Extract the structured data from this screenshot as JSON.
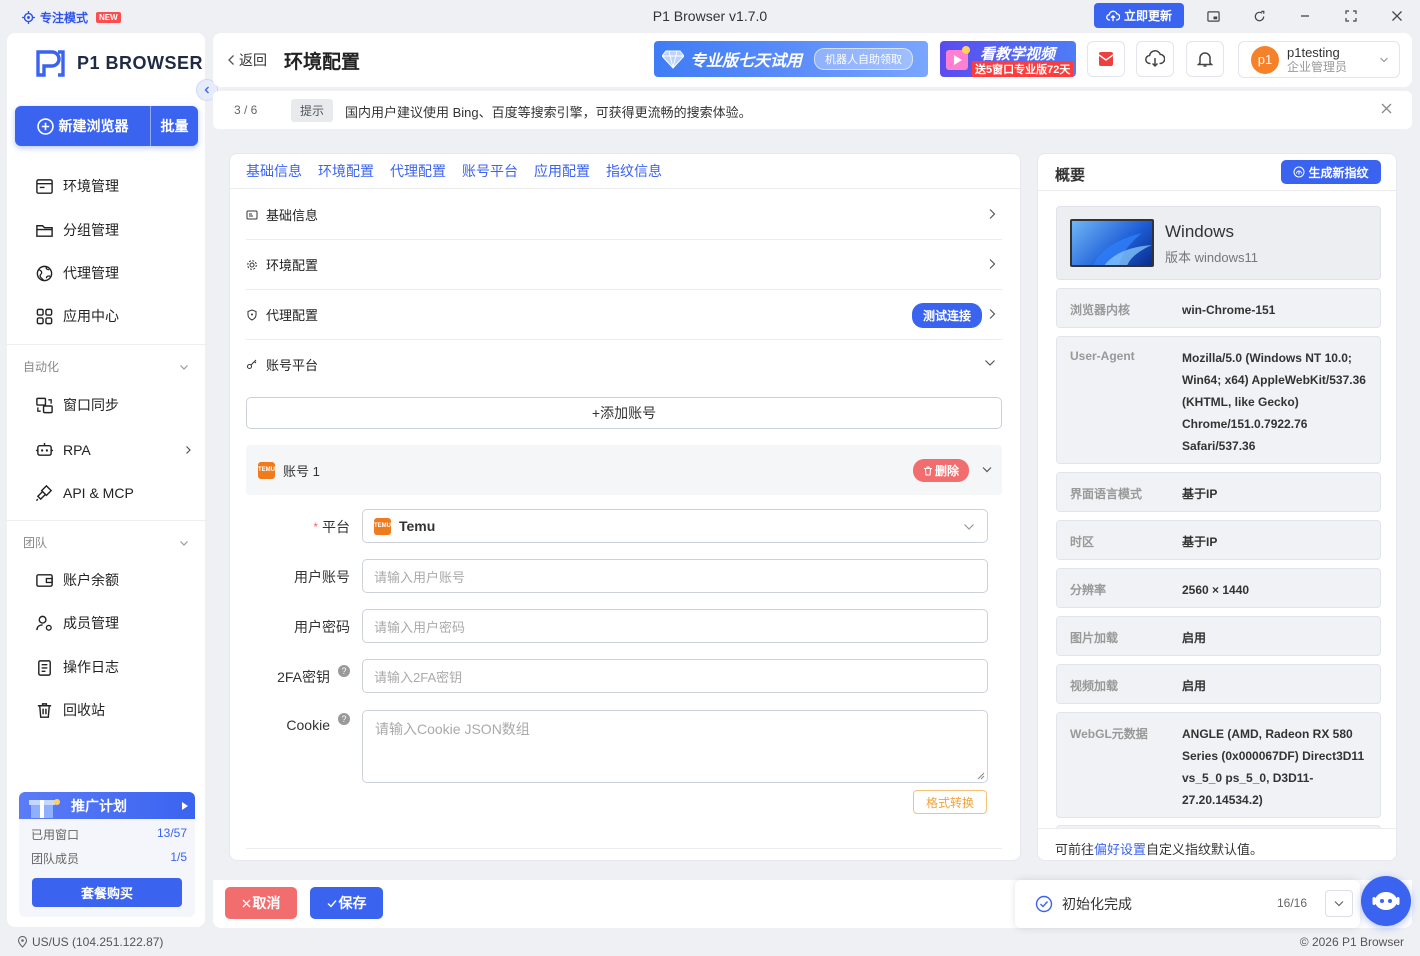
{
  "titlebar": {
    "focus_mode": "专注模式",
    "new_badge": "NEW",
    "title": "P1 Browser v1.7.0",
    "update_label": "立即更新"
  },
  "sidebar": {
    "logo_text": "P1 BROWSER",
    "new_browser": "新建浏览器",
    "batch": "批量",
    "items": [
      {
        "label": "环境管理"
      },
      {
        "label": "分组管理"
      },
      {
        "label": "代理管理"
      },
      {
        "label": "应用中心"
      }
    ],
    "automation_label": "自动化",
    "automation_items": [
      {
        "label": "窗口同步"
      },
      {
        "label": "RPA"
      },
      {
        "label": "API & MCP"
      }
    ],
    "team_label": "团队",
    "team_items": [
      {
        "label": "账户余额"
      },
      {
        "label": "成员管理"
      },
      {
        "label": "操作日志"
      },
      {
        "label": "回收站"
      }
    ],
    "promo": {
      "title": "推广计划",
      "windows_label": "已用窗口",
      "windows_value": "13/57",
      "members_label": "团队成员",
      "members_value": "1/5",
      "buy_label": "套餐购买"
    }
  },
  "header": {
    "back": "返回",
    "title": "环境配置",
    "banner1_text": "专业版七天试用",
    "banner1_pill": "机器人自助领取",
    "banner2_line1": "看教学视频",
    "banner2_line2": "送5窗口专业版72天",
    "user_name": "p1testing",
    "user_role": "企业管理员",
    "avatar_text": "p1"
  },
  "tip": {
    "page": "3 / 6",
    "tag": "提示",
    "text": "国内用户建议使用 Bing、百度等搜索引擎，可获得更流畅的搜索体验。"
  },
  "tabs": [
    "基础信息",
    "环境配置",
    "代理配置",
    "账号平台",
    "应用配置",
    "指纹信息"
  ],
  "sections": {
    "basic": "基础信息",
    "env": "环境配置",
    "proxy": "代理配置",
    "test_conn": "测试连接",
    "account": "账号平台"
  },
  "account": {
    "add_label": "+添加账号",
    "header": "账号 1",
    "delete_label": "删除",
    "platform_label": "平台",
    "platform_value": "Temu",
    "username_label": "用户账号",
    "username_placeholder": "请输入用户账号",
    "password_label": "用户密码",
    "password_placeholder": "请输入用户密码",
    "twofa_label": "2FA密钥",
    "twofa_placeholder": "请输入2FA密钥",
    "cookie_label": "Cookie",
    "cookie_placeholder": "请输入Cookie JSON数组",
    "format_label": "格式转换"
  },
  "overview": {
    "title": "概要",
    "generate": "生成新指纹",
    "os_name": "Windows",
    "os_version": "版本 windows11",
    "rows": [
      {
        "k": "浏览器内核",
        "v": "win-Chrome-151"
      },
      {
        "k": "User-Agent",
        "v": "Mozilla/5.0 (Windows NT 10.0; Win64; x64) AppleWebKit/537.36 (KHTML, like Gecko) Chrome/151.0.7922.76 Safari/537.36"
      },
      {
        "k": "界面语言模式",
        "v": "基于IP"
      },
      {
        "k": "时区",
        "v": "基于IP"
      },
      {
        "k": "分辨率",
        "v": "2560 × 1440"
      },
      {
        "k": "图片加载",
        "v": "启用"
      },
      {
        "k": "视频加载",
        "v": "启用"
      },
      {
        "k": "WebGL元数据",
        "v": "ANGLE (AMD, Radeon RX 580 Series (0x000067DF) Direct3D11 vs_5_0 ps_5_0, D3D11-27.20.14534.2)"
      }
    ],
    "foot_prefix": "可前往",
    "foot_link": "偏好设置",
    "foot_suffix": "自定义指纹默认值。"
  },
  "bottom": {
    "cancel": "取消",
    "save": "保存",
    "init_text": "初始化完成",
    "init_count": "16/16"
  },
  "status": {
    "location": "US/US (104.251.122.87)",
    "copyright": "© 2026 P1 Browser"
  },
  "colors": {
    "accent": "#3a63f0",
    "danger": "#f26d6d",
    "warning": "#f0a33a"
  }
}
